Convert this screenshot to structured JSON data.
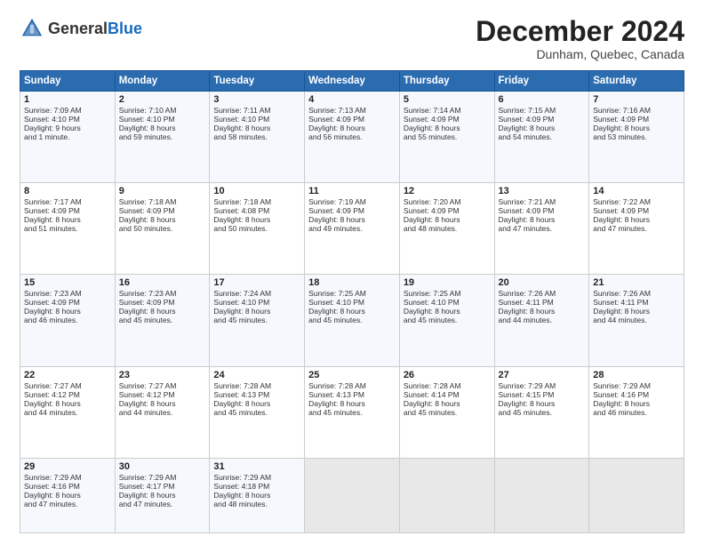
{
  "header": {
    "logo_general": "General",
    "logo_blue": "Blue",
    "month_title": "December 2024",
    "location": "Dunham, Quebec, Canada"
  },
  "days_of_week": [
    "Sunday",
    "Monday",
    "Tuesday",
    "Wednesday",
    "Thursday",
    "Friday",
    "Saturday"
  ],
  "weeks": [
    [
      {
        "day": 1,
        "lines": [
          "Sunrise: 7:09 AM",
          "Sunset: 4:10 PM",
          "Daylight: 9 hours",
          "and 1 minute."
        ]
      },
      {
        "day": 2,
        "lines": [
          "Sunrise: 7:10 AM",
          "Sunset: 4:10 PM",
          "Daylight: 8 hours",
          "and 59 minutes."
        ]
      },
      {
        "day": 3,
        "lines": [
          "Sunrise: 7:11 AM",
          "Sunset: 4:10 PM",
          "Daylight: 8 hours",
          "and 58 minutes."
        ]
      },
      {
        "day": 4,
        "lines": [
          "Sunrise: 7:13 AM",
          "Sunset: 4:09 PM",
          "Daylight: 8 hours",
          "and 56 minutes."
        ]
      },
      {
        "day": 5,
        "lines": [
          "Sunrise: 7:14 AM",
          "Sunset: 4:09 PM",
          "Daylight: 8 hours",
          "and 55 minutes."
        ]
      },
      {
        "day": 6,
        "lines": [
          "Sunrise: 7:15 AM",
          "Sunset: 4:09 PM",
          "Daylight: 8 hours",
          "and 54 minutes."
        ]
      },
      {
        "day": 7,
        "lines": [
          "Sunrise: 7:16 AM",
          "Sunset: 4:09 PM",
          "Daylight: 8 hours",
          "and 53 minutes."
        ]
      }
    ],
    [
      {
        "day": 8,
        "lines": [
          "Sunrise: 7:17 AM",
          "Sunset: 4:09 PM",
          "Daylight: 8 hours",
          "and 51 minutes."
        ]
      },
      {
        "day": 9,
        "lines": [
          "Sunrise: 7:18 AM",
          "Sunset: 4:09 PM",
          "Daylight: 8 hours",
          "and 50 minutes."
        ]
      },
      {
        "day": 10,
        "lines": [
          "Sunrise: 7:18 AM",
          "Sunset: 4:08 PM",
          "Daylight: 8 hours",
          "and 50 minutes."
        ]
      },
      {
        "day": 11,
        "lines": [
          "Sunrise: 7:19 AM",
          "Sunset: 4:09 PM",
          "Daylight: 8 hours",
          "and 49 minutes."
        ]
      },
      {
        "day": 12,
        "lines": [
          "Sunrise: 7:20 AM",
          "Sunset: 4:09 PM",
          "Daylight: 8 hours",
          "and 48 minutes."
        ]
      },
      {
        "day": 13,
        "lines": [
          "Sunrise: 7:21 AM",
          "Sunset: 4:09 PM",
          "Daylight: 8 hours",
          "and 47 minutes."
        ]
      },
      {
        "day": 14,
        "lines": [
          "Sunrise: 7:22 AM",
          "Sunset: 4:09 PM",
          "Daylight: 8 hours",
          "and 47 minutes."
        ]
      }
    ],
    [
      {
        "day": 15,
        "lines": [
          "Sunrise: 7:23 AM",
          "Sunset: 4:09 PM",
          "Daylight: 8 hours",
          "and 46 minutes."
        ]
      },
      {
        "day": 16,
        "lines": [
          "Sunrise: 7:23 AM",
          "Sunset: 4:09 PM",
          "Daylight: 8 hours",
          "and 45 minutes."
        ]
      },
      {
        "day": 17,
        "lines": [
          "Sunrise: 7:24 AM",
          "Sunset: 4:10 PM",
          "Daylight: 8 hours",
          "and 45 minutes."
        ]
      },
      {
        "day": 18,
        "lines": [
          "Sunrise: 7:25 AM",
          "Sunset: 4:10 PM",
          "Daylight: 8 hours",
          "and 45 minutes."
        ]
      },
      {
        "day": 19,
        "lines": [
          "Sunrise: 7:25 AM",
          "Sunset: 4:10 PM",
          "Daylight: 8 hours",
          "and 45 minutes."
        ]
      },
      {
        "day": 20,
        "lines": [
          "Sunrise: 7:26 AM",
          "Sunset: 4:11 PM",
          "Daylight: 8 hours",
          "and 44 minutes."
        ]
      },
      {
        "day": 21,
        "lines": [
          "Sunrise: 7:26 AM",
          "Sunset: 4:11 PM",
          "Daylight: 8 hours",
          "and 44 minutes."
        ]
      }
    ],
    [
      {
        "day": 22,
        "lines": [
          "Sunrise: 7:27 AM",
          "Sunset: 4:12 PM",
          "Daylight: 8 hours",
          "and 44 minutes."
        ]
      },
      {
        "day": 23,
        "lines": [
          "Sunrise: 7:27 AM",
          "Sunset: 4:12 PM",
          "Daylight: 8 hours",
          "and 44 minutes."
        ]
      },
      {
        "day": 24,
        "lines": [
          "Sunrise: 7:28 AM",
          "Sunset: 4:13 PM",
          "Daylight: 8 hours",
          "and 45 minutes."
        ]
      },
      {
        "day": 25,
        "lines": [
          "Sunrise: 7:28 AM",
          "Sunset: 4:13 PM",
          "Daylight: 8 hours",
          "and 45 minutes."
        ]
      },
      {
        "day": 26,
        "lines": [
          "Sunrise: 7:28 AM",
          "Sunset: 4:14 PM",
          "Daylight: 8 hours",
          "and 45 minutes."
        ]
      },
      {
        "day": 27,
        "lines": [
          "Sunrise: 7:29 AM",
          "Sunset: 4:15 PM",
          "Daylight: 8 hours",
          "and 45 minutes."
        ]
      },
      {
        "day": 28,
        "lines": [
          "Sunrise: 7:29 AM",
          "Sunset: 4:16 PM",
          "Daylight: 8 hours",
          "and 46 minutes."
        ]
      }
    ],
    [
      {
        "day": 29,
        "lines": [
          "Sunrise: 7:29 AM",
          "Sunset: 4:16 PM",
          "Daylight: 8 hours",
          "and 47 minutes."
        ]
      },
      {
        "day": 30,
        "lines": [
          "Sunrise: 7:29 AM",
          "Sunset: 4:17 PM",
          "Daylight: 8 hours",
          "and 47 minutes."
        ]
      },
      {
        "day": 31,
        "lines": [
          "Sunrise: 7:29 AM",
          "Sunset: 4:18 PM",
          "Daylight: 8 hours",
          "and 48 minutes."
        ]
      },
      null,
      null,
      null,
      null
    ]
  ]
}
